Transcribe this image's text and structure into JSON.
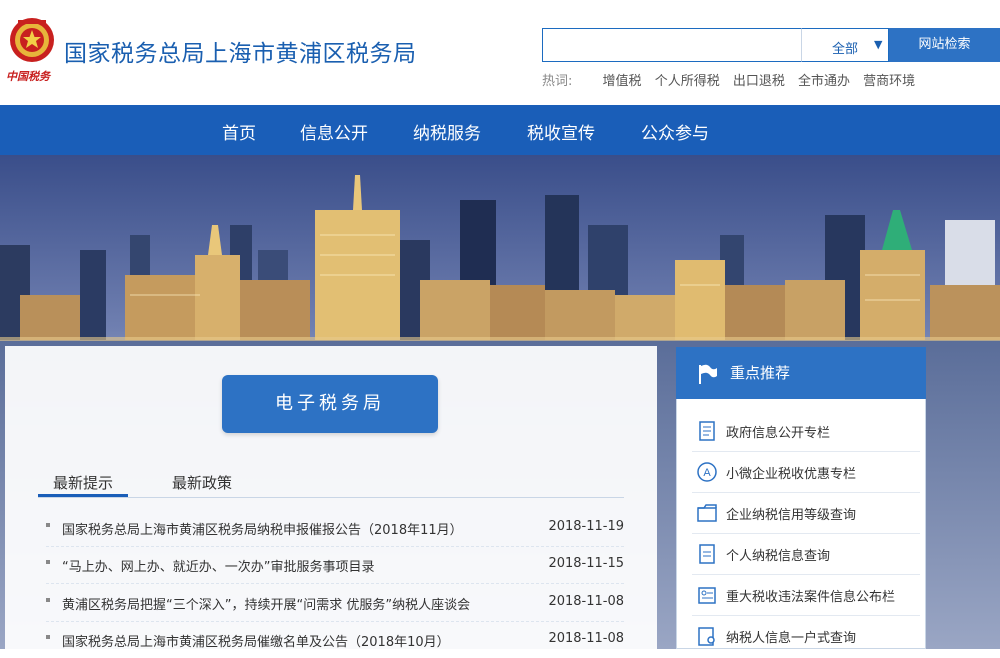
{
  "header": {
    "logo_text": "中国税务",
    "site_title": "国家税务总局上海市黄浦区税务局",
    "search": {
      "placeholder": "",
      "scope": "全部",
      "button": "网站检索"
    },
    "hotwords_label": "热词:",
    "hotwords": [
      "增值税",
      "个人所得税",
      "出口退税",
      "全市通办",
      "营商环境"
    ]
  },
  "nav": {
    "items": [
      "首页",
      "信息公开",
      "纳税服务",
      "税收宣传",
      "公众参与"
    ]
  },
  "left": {
    "eservice_button": "电子税务局",
    "tabs": [
      "最新提示",
      "最新政策"
    ],
    "active_tab": "最新提示",
    "news": [
      {
        "title": "国家税务总局上海市黄浦区税务局纳税申报催报公告（2018年11月）",
        "date": "2018-11-19"
      },
      {
        "title": "“马上办、网上办、就近办、一次办”审批服务事项目录",
        "date": "2018-11-15"
      },
      {
        "title": "黄浦区税务局把握“三个深入”，持续开展“问需求 优服务”纳税人座谈会",
        "date": "2018-11-08"
      },
      {
        "title": "国家税务总局上海市黄浦区税务局催缴名单及公告（2018年10月）",
        "date": "2018-11-08"
      }
    ]
  },
  "right": {
    "title": "重点推荐",
    "items": [
      {
        "label": "政府信息公开专栏",
        "icon": "document-list-icon"
      },
      {
        "label": "小微企业税收优惠专栏",
        "icon": "tax-preference-icon"
      },
      {
        "label": "企业纳税信用等级查询",
        "icon": "credit-folder-icon"
      },
      {
        "label": "个人纳税信息查询",
        "icon": "personal-doc-icon"
      },
      {
        "label": "重大税收违法案件信息公布栏",
        "icon": "case-board-icon"
      },
      {
        "label": "纳税人信息一户式查询",
        "icon": "taxpayer-query-icon"
      }
    ]
  },
  "colors": {
    "brand_blue": "#1a5eb8",
    "button_blue": "#2d72c4",
    "title_blue": "#1a5fb0"
  }
}
